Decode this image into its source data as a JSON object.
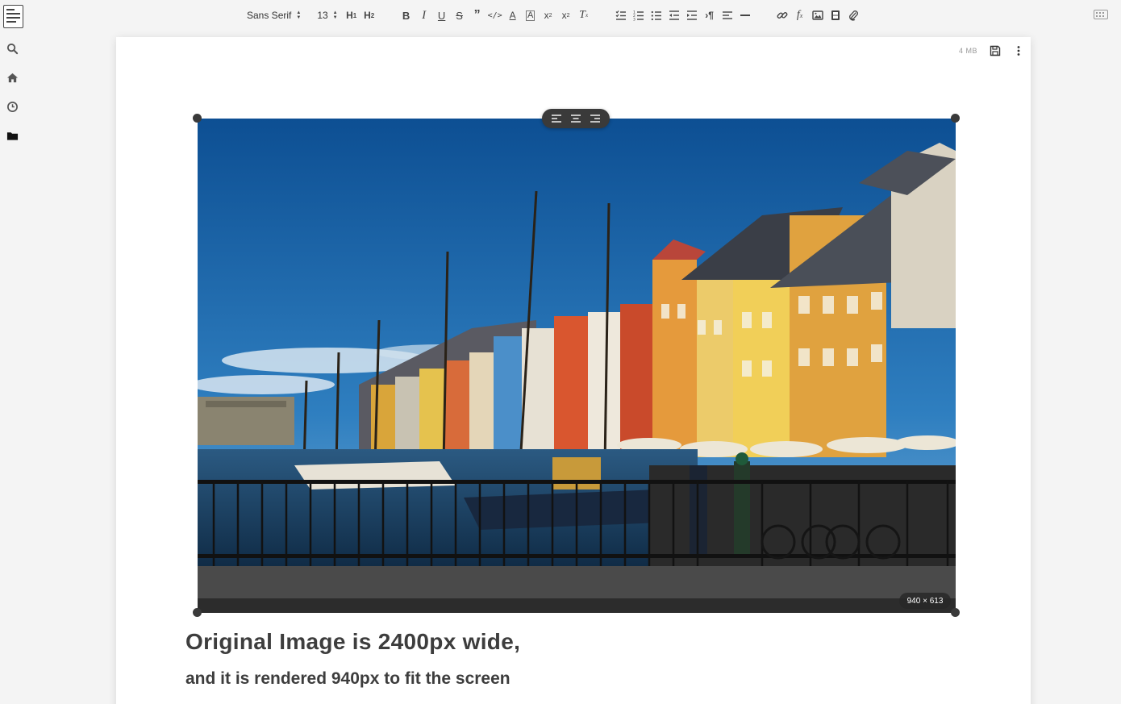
{
  "toolbar": {
    "font_family": "Sans Serif",
    "font_size": "13",
    "h1_label": "H1",
    "h2_label": "H2",
    "groups": {
      "format": [
        "bold-icon",
        "italic-icon",
        "underline-icon",
        "strikethrough-icon",
        "blockquote-icon",
        "code-icon",
        "text-color-icon",
        "highlight-icon",
        "subscript-icon",
        "superscript-icon",
        "clear-format-icon"
      ],
      "blocks": [
        "checklist-icon",
        "ordered-list-icon",
        "bullet-list-icon",
        "outdent-icon",
        "indent-icon",
        "text-direction-icon",
        "align-left-icon",
        "horizontal-rule-icon"
      ],
      "insert": [
        "link-icon",
        "formula-icon",
        "image-icon",
        "video-icon",
        "attachment-icon"
      ]
    }
  },
  "rail": {
    "items": [
      "search-icon",
      "home-icon",
      "history-icon",
      "folder-icon"
    ]
  },
  "page": {
    "file_size": "4 MB"
  },
  "image": {
    "dimensions_label": "940 × 613",
    "align_options": [
      "align-left-icon",
      "align-center-icon",
      "align-right-icon"
    ]
  },
  "content": {
    "heading": "Original Image is 2400px wide,",
    "subheading": "and it is rendered 940px to fit the screen"
  },
  "colors": {
    "handle": "#3a3a3a",
    "heading": "#3d3d3d",
    "page_bg": "#ffffff",
    "app_bg": "#f4f4f4"
  }
}
